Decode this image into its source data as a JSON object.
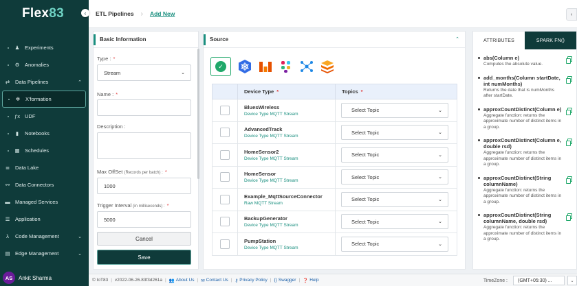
{
  "app": {
    "logo_text": "Flex",
    "logo_num": "83"
  },
  "sidebar": {
    "items": [
      {
        "label": "Experiments",
        "icon": "flask-icon"
      },
      {
        "label": "Anomalies",
        "icon": "anomaly-icon"
      },
      {
        "label": "Data Pipelines",
        "icon": "pipeline-icon"
      },
      {
        "label": "X'formation",
        "icon": "transform-icon"
      },
      {
        "label": "UDF",
        "icon": "function-icon"
      },
      {
        "label": "Notebooks",
        "icon": "notebook-icon"
      },
      {
        "label": "Schedules",
        "icon": "schedule-icon"
      },
      {
        "label": "Data Lake",
        "icon": "database-icon"
      },
      {
        "label": "Data Connectors",
        "icon": "connector-icon"
      },
      {
        "label": "Managed Services",
        "icon": "services-icon"
      },
      {
        "label": "Application",
        "icon": "menu-icon"
      },
      {
        "label": "Code Management",
        "icon": "code-icon"
      },
      {
        "label": "Edge Management",
        "icon": "edge-icon"
      }
    ],
    "user": {
      "initials": "AS",
      "name": "Ankit Sharma"
    }
  },
  "header": {
    "crumb": "ETL Pipelines",
    "link": "Add New"
  },
  "basic": {
    "title": "Basic Information",
    "type_label": "Type :",
    "type_value": "Stream",
    "name_label": "Name :",
    "desc_label": "Description :",
    "offset_label": "Max OffSet",
    "offset_hint": "(Records per batch) :",
    "offset_value": "1000",
    "trigger_label": "Trigger Interval",
    "trigger_hint": "(in milliseconds) :",
    "trigger_value": "5000",
    "cancel": "Cancel",
    "save": "Save"
  },
  "source": {
    "title": "Source",
    "col_device": "Device Type",
    "col_topics": "Topics",
    "rows": [
      {
        "name": "BluesWireless",
        "sub": "Device Type MQTT Stream",
        "topic": "Select Topic"
      },
      {
        "name": "AdvancedTrack",
        "sub": "Device Type MQTT Stream",
        "topic": "Select Topic"
      },
      {
        "name": "HomeSensor2",
        "sub": "Device Type MQTT Stream",
        "topic": "Select Topic"
      },
      {
        "name": "HomeSensor",
        "sub": "Device Type MQTT Stream",
        "topic": "Select Topic"
      },
      {
        "name": "Example_MqttSourceConnector",
        "sub": "Raw MQTT Stream",
        "topic": "Select Topic"
      },
      {
        "name": "BackupGenerator",
        "sub": "Device Type MQTT Stream",
        "topic": "Select Topic"
      },
      {
        "name": "PumpStation",
        "sub": "Device Type MQTT Stream",
        "topic": "Select Topic"
      }
    ]
  },
  "attrs": {
    "tab_attributes": "ATTRIBUTES",
    "tab_spark": "SPARK FN()",
    "functions": [
      {
        "name": "abs(Column e)",
        "desc": "Computes the absolute value."
      },
      {
        "name": "add_months(Column startDate, int numMonths)",
        "desc": "Returns the date that is numMonths after startDate."
      },
      {
        "name": "approxCountDistinct(Column e)",
        "desc": "Aggregate function: returns the approximate number of distinct items in a group."
      },
      {
        "name": "approxCountDistinct(Column e, double rsd)",
        "desc": "Aggregate function: returns the approximate number of distinct items in a group."
      },
      {
        "name": "approxCountDistinct(String columnName)",
        "desc": "Aggregate function: returns the approximate number of distinct items in a group."
      },
      {
        "name": "approxCountDistinct(String columnName, double rsd)",
        "desc": "Aggregate function: returns the approximate number of distinct items in a group."
      }
    ]
  },
  "footer": {
    "copyright": "© IoT83",
    "version": "v2022-06-26.83f3d261a",
    "about": "About Us",
    "contact": "Contact Us",
    "privacy": "Privacy Policy",
    "swagger": "Swagger",
    "help": "Help",
    "tz_label": "TimeZone :",
    "tz_value": "(GMT+05:30) ..."
  },
  "colors": {
    "brand_dark": "#0f3b3a",
    "accent": "#1a8f7f",
    "required": "#e03c3c"
  }
}
